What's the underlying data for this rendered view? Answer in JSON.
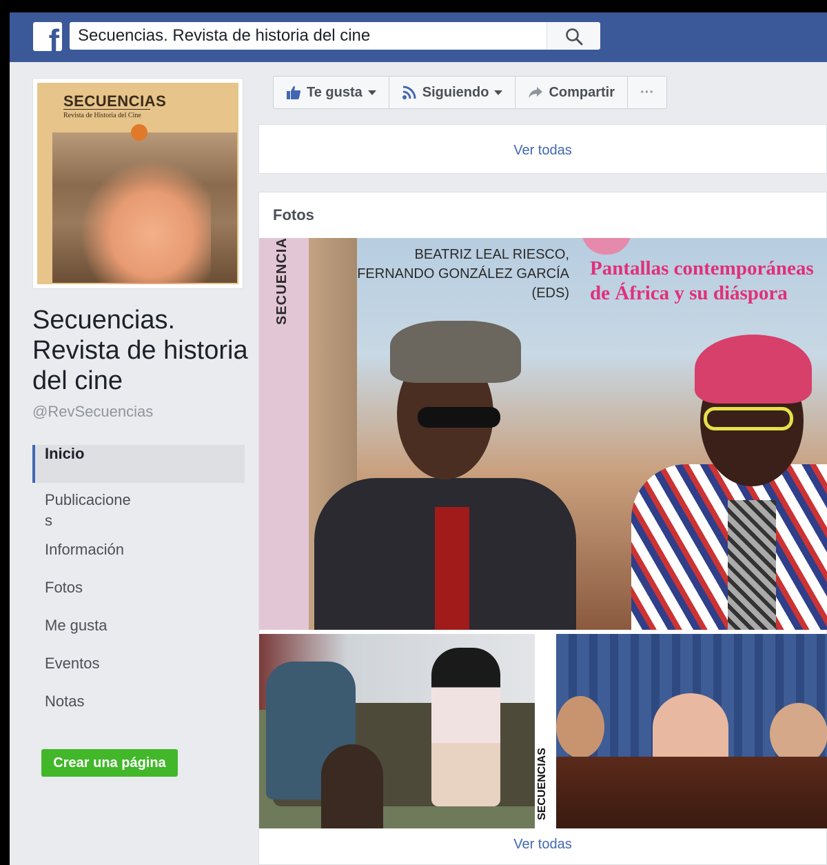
{
  "header": {
    "search_value": "Secuencias. Revista de historia del cine",
    "search_icon": "search-icon",
    "logo_icon": "facebook-f-icon",
    "brand_color": "#3b5998"
  },
  "profile": {
    "cover": {
      "magazine_title": "SECUENCIAS",
      "magazine_subtitle": "Revista de Historia del Cine"
    },
    "name": "Secuencias. Revista de historia del cine",
    "handle": "@RevSecuencias"
  },
  "nav": {
    "items": [
      {
        "label": "Inicio",
        "active": true
      },
      {
        "label": "Publicaciones",
        "active": false
      },
      {
        "label": "Información",
        "active": false
      },
      {
        "label": "Fotos",
        "active": false
      },
      {
        "label": "Me gusta",
        "active": false
      },
      {
        "label": "Eventos",
        "active": false
      },
      {
        "label": "Notas",
        "active": false
      }
    ],
    "create_page": "Crear una página",
    "create_color": "#42b72a"
  },
  "actions": {
    "like": "Te gusta",
    "follow": "Siguiendo",
    "share": "Compartir",
    "more": "···"
  },
  "card1": {
    "see_all": "Ver todas"
  },
  "photos": {
    "title": "Fotos",
    "main": {
      "spine": "SECUENCIA",
      "authors": [
        "BEATRIZ LEAL RIESCO,",
        "FERNANDO GONZÁLEZ GARCÍA",
        "(EDS)"
      ],
      "book_title": "Pantallas contemporáneas de África y su diáspora"
    },
    "bottom_left": {
      "spine": "SECUENCIAS"
    },
    "see_all": "Ver todas"
  }
}
